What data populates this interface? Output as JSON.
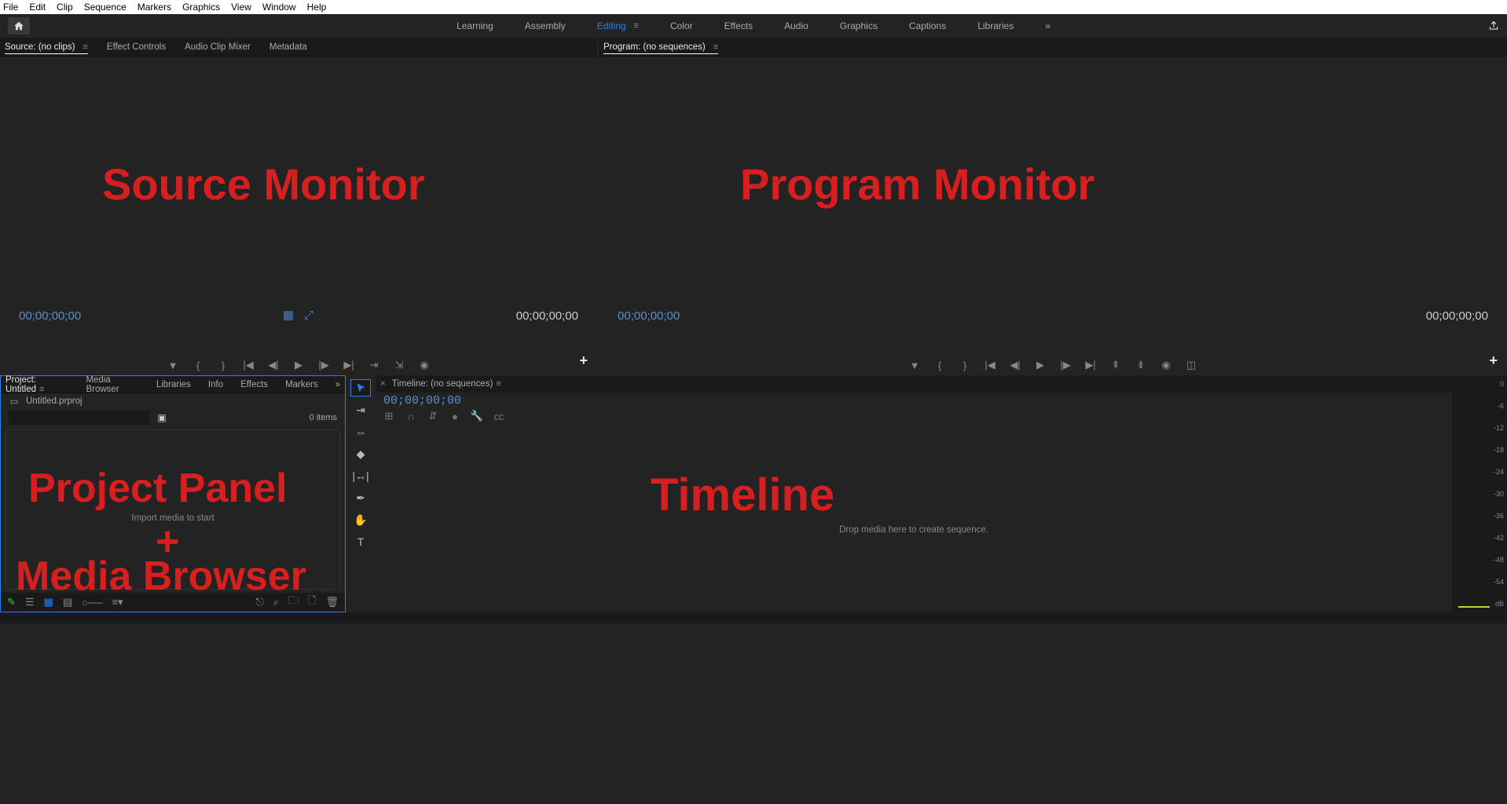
{
  "menu": [
    "File",
    "Edit",
    "Clip",
    "Sequence",
    "Markers",
    "Graphics",
    "View",
    "Window",
    "Help"
  ],
  "workspaces": {
    "items": [
      "Learning",
      "Assembly",
      "Editing",
      "Color",
      "Effects",
      "Audio",
      "Graphics",
      "Captions",
      "Libraries"
    ],
    "active": "Editing",
    "overflow": "»"
  },
  "source": {
    "tabs": [
      "Source: (no clips)",
      "Effect Controls",
      "Audio Clip Mixer",
      "Metadata"
    ],
    "active_tab": "Source: (no clips)",
    "annotation": "Source Monitor",
    "tc_left": "00;00;00;00",
    "tc_right": "00;00;00;00"
  },
  "program": {
    "tab": "Program: (no sequences)",
    "annotation": "Program Monitor",
    "tc_left": "00;00;00;00",
    "tc_right": "00;00;00;00"
  },
  "project": {
    "tabs": [
      "Project: Untitled",
      "Media Browser",
      "Libraries",
      "Info",
      "Effects",
      "Markers"
    ],
    "active_tab": "Project: Untitled",
    "overflow": "»",
    "filename": "Untitled.prproj",
    "items_count": "0 items",
    "import_hint": "Import media to start",
    "annotation_l1": "Project Panel",
    "annotation_plus": "+",
    "annotation_l2": "Media Browser"
  },
  "tools": [
    "selection",
    "track-select",
    "ripple",
    "razor",
    "slip",
    "pen",
    "hand",
    "type"
  ],
  "timeline": {
    "tab": "Timeline: (no sequences)",
    "tc": "00;00;00;00",
    "drop_hint": "Drop media here to create sequence.",
    "annotation": "Timeline"
  },
  "meter": {
    "ticks": [
      "0",
      "-6",
      "-12",
      "-18",
      "-24",
      "-30",
      "-36",
      "-42",
      "-48",
      "-54",
      "dB"
    ]
  },
  "colors": {
    "accent": "#2680eb",
    "annotation": "#d81f1f"
  }
}
